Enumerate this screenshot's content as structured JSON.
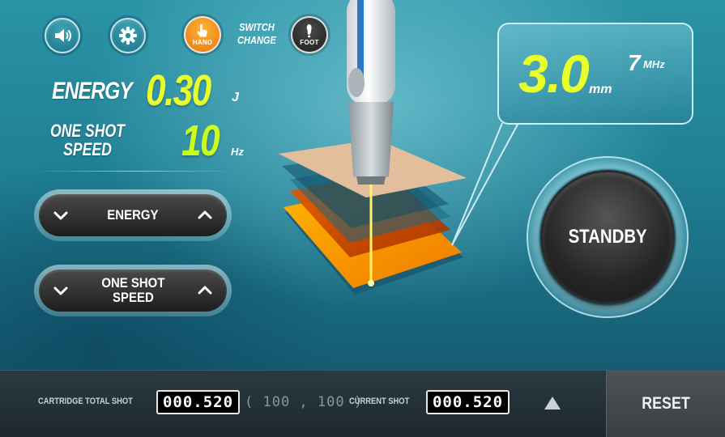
{
  "top_icons": {
    "volume_icon": "speaker-icon",
    "settings_icon": "gear-icon",
    "hand_icon": "hand-pointer-icon",
    "hand_label": "HAND",
    "switch_label_1": "SWITCH",
    "switch_label_2": "CHANGE",
    "foot_icon": "footprint-icon",
    "foot_label": "FOOT"
  },
  "readouts": {
    "energy_label": "ENERGY",
    "energy_value": "0.30",
    "energy_unit": "J",
    "speed_label_1": "ONE SHOT",
    "speed_label_2": "SPEED",
    "speed_value": "10",
    "speed_unit": "Hz"
  },
  "controls": {
    "energy_label": "ENERGY",
    "speed_label_1": "ONE SHOT",
    "speed_label_2": "SPEED"
  },
  "depth": {
    "value": "3.0",
    "unit": "mm",
    "frequency_value": "7",
    "frequency_unit": "MHz"
  },
  "standby_label": "STANDBY",
  "bottom_bar": {
    "cartridge_label": "CARTRIDGE TOTAL SHOT",
    "cartridge_value": "000.520",
    "cartridge_range": "( 100 , 100 )",
    "current_label": "CURRENT SHOT",
    "current_value": "000.520",
    "reset_label": "RESET"
  },
  "colors": {
    "value_yellow": "#e8ff2a",
    "hand_orange": "#f0900f",
    "background_teal": "#1f7f94"
  }
}
